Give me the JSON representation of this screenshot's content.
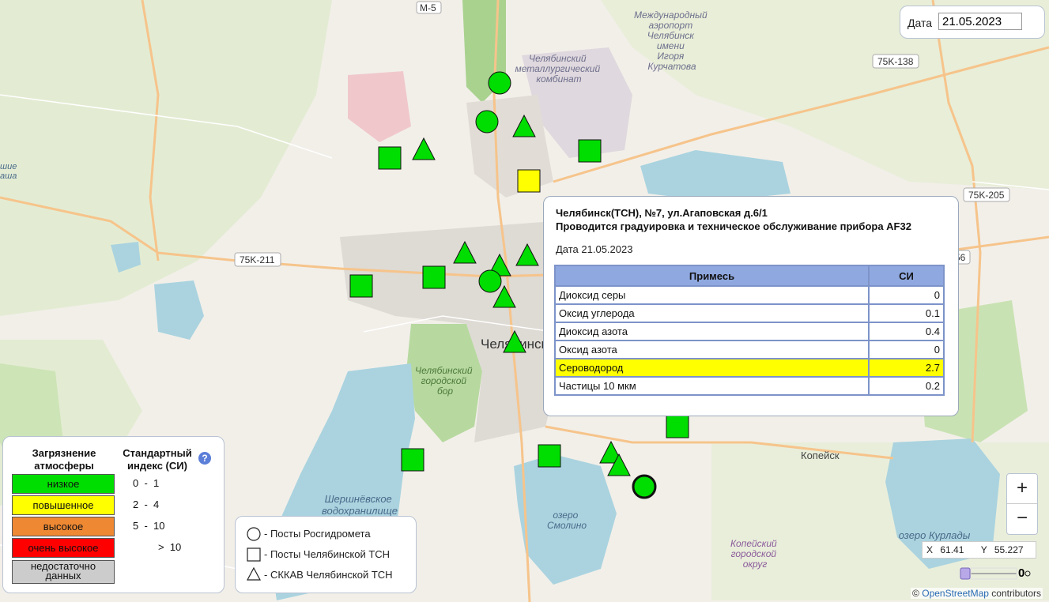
{
  "map": {
    "road_labels": [
      "M-5",
      "75K-138",
      "75K-211",
      "75K-205",
      "56"
    ],
    "place_labels": [
      [
        "Международный",
        "аэропорт",
        "Челябинск",
        "имени",
        "Игоря",
        "Курчатова"
      ],
      [
        "Челябинский",
        "металлургический",
        "комбинат"
      ],
      [
        "Челябинский",
        "городской",
        "бор"
      ],
      [
        "Шершнёвское",
        "водохранилище"
      ],
      [
        "озеро",
        "Смолино"
      ],
      [
        "Копейский",
        "городской",
        "округ"
      ],
      [
        "озеро Курлады"
      ],
      [
        "Копейск"
      ],
      [
        "Челябинск"
      ],
      [
        "шие",
        "аша"
      ]
    ],
    "marker_colors": {
      "low": "#00dd00",
      "elevated": "#ffff00"
    },
    "markers": [
      {
        "shape": "circle",
        "level": "low"
      },
      {
        "shape": "circle",
        "level": "low"
      },
      {
        "shape": "triangle",
        "level": "low"
      },
      {
        "shape": "triangle",
        "level": "low"
      },
      {
        "shape": "square",
        "level": "low"
      },
      {
        "shape": "square",
        "level": "low"
      },
      {
        "shape": "square",
        "level": "elevated"
      },
      {
        "shape": "triangle",
        "level": "low"
      },
      {
        "shape": "triangle",
        "level": "low"
      },
      {
        "shape": "triangle",
        "level": "low"
      },
      {
        "shape": "circle",
        "level": "low"
      },
      {
        "shape": "triangle",
        "level": "low"
      },
      {
        "shape": "square",
        "level": "low"
      },
      {
        "shape": "square",
        "level": "low"
      },
      {
        "shape": "triangle",
        "level": "low"
      },
      {
        "shape": "square",
        "level": "low"
      },
      {
        "shape": "square",
        "level": "low"
      },
      {
        "shape": "square",
        "level": "low"
      },
      {
        "shape": "triangle",
        "level": "low"
      },
      {
        "shape": "triangle",
        "level": "low"
      },
      {
        "shape": "circle",
        "level": "low",
        "selected": true
      }
    ]
  },
  "date_control": {
    "label": "Дата",
    "value": "21.05.2023"
  },
  "popup": {
    "title_line1": "Челябинск(ТСН), №7, ул.Агаповская д.6/1",
    "title_line2": "Проводится градуировка и техническое обслуживание прибора AF32",
    "date_text": "Дата 21.05.2023",
    "headers": [
      "Примесь",
      "СИ"
    ],
    "header_color": "#8fa8df",
    "highlight_color": "#ffff00",
    "rows": [
      {
        "name": "Диоксид серы",
        "value": "0",
        "highlight": false
      },
      {
        "name": "Оксид углерода",
        "value": "0.1",
        "highlight": false
      },
      {
        "name": "Диоксид азота",
        "value": "0.4",
        "highlight": false
      },
      {
        "name": "Оксид азота",
        "value": "0",
        "highlight": false
      },
      {
        "name": "Сероводород",
        "value": "2.7",
        "highlight": true
      },
      {
        "name": "Частицы 10 мкм",
        "value": "0.2",
        "highlight": false
      }
    ]
  },
  "legend": {
    "header_pollution": "Загрязнение атмосферы",
    "header_index": "Стандартный индекс (СИ)",
    "help_icon": "?",
    "levels": [
      {
        "label": "низкое",
        "range": "0  -  1",
        "color": "#00dd00"
      },
      {
        "label": "повышенное",
        "range": "2  -  4",
        "color": "#ffff00"
      },
      {
        "label": "высокое",
        "range": "5  -  10",
        "color": "#ee8833"
      },
      {
        "label": "очень высокое",
        "range": ">  10",
        "color": "#ff0000"
      },
      {
        "label": "недостаточно данных",
        "range": "",
        "color": "#cccccc"
      }
    ]
  },
  "symbols": [
    {
      "icon": "circle-icon",
      "label": "- Посты Росгидромета"
    },
    {
      "icon": "square-icon",
      "label": "- Посты Челябинской ТСН"
    },
    {
      "icon": "triangle-icon",
      "label": "- СККАВ Челябинской ТСН"
    }
  ],
  "zoom": {
    "in": "+",
    "out": "−"
  },
  "coords": {
    "x_label": "X",
    "x": "61.41",
    "y_label": "Y",
    "y": "55.227"
  },
  "slider": {
    "value": "0"
  },
  "attribution": {
    "prefix": "©",
    "link": "OpenStreetMap",
    "suffix": "contributors"
  }
}
